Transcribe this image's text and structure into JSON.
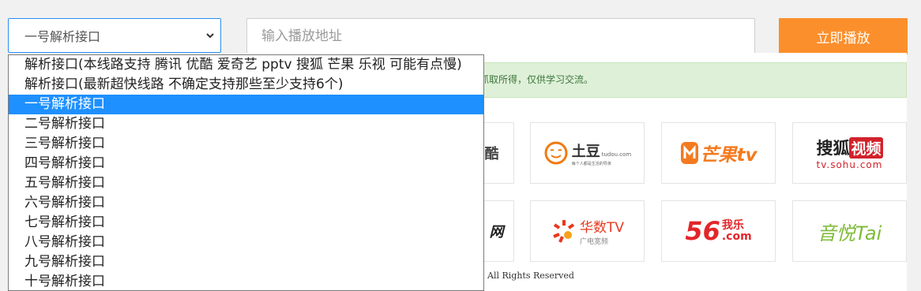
{
  "interface_select": {
    "selected": "一号解析接口",
    "options": [
      "解析接口(本线路支持 腾讯 优酷 爱奇艺 pptv 搜狐 芒果 乐视 可能有点慢)",
      "解析接口(最新超快线路 不确定支持那些至少支持6个)",
      "一号解析接口",
      "二号解析接口",
      "三号解析接口",
      "四号解析接口",
      "五号解析接口",
      "六号解析接口",
      "七号解析接口",
      "八号解析接口",
      "九号解析接口",
      "十号解析接口"
    ]
  },
  "url_input": {
    "placeholder": "输入播放地址",
    "value": ""
  },
  "play_button": {
    "label": "立即播放"
  },
  "notice": {
    "text": "抓取所得，仅供学习交流。"
  },
  "platforms": {
    "row1": [
      {
        "label": "优酷",
        "icon": "youku-logo"
      },
      {
        "label": "土豆",
        "sub": "tudou.com",
        "tagline": "每个人都是生活的导演",
        "icon": "tudou-logo"
      },
      {
        "label": "芒果tv",
        "icon": "mango-logo"
      },
      {
        "label": "搜狐",
        "badge": "视频",
        "sub": "tv.sohu.com",
        "icon": "sohu-logo"
      }
    ],
    "row2": [
      {
        "label": "网",
        "icon": "partial-logo"
      },
      {
        "label": "华数TV",
        "sub": "广电宽频",
        "icon": "wasu-logo"
      },
      {
        "label": "56",
        "badge": "我乐",
        "sub": ".com",
        "icon": "56-logo"
      },
      {
        "label": "音悦Tai",
        "icon": "yinyuetai-logo"
      }
    ]
  },
  "footer": {
    "copyright": "All Rights Reserved"
  },
  "colors": {
    "accent": "#fb8f2c",
    "selection": "#1e90ff",
    "notice_bg": "#dff0d8"
  }
}
